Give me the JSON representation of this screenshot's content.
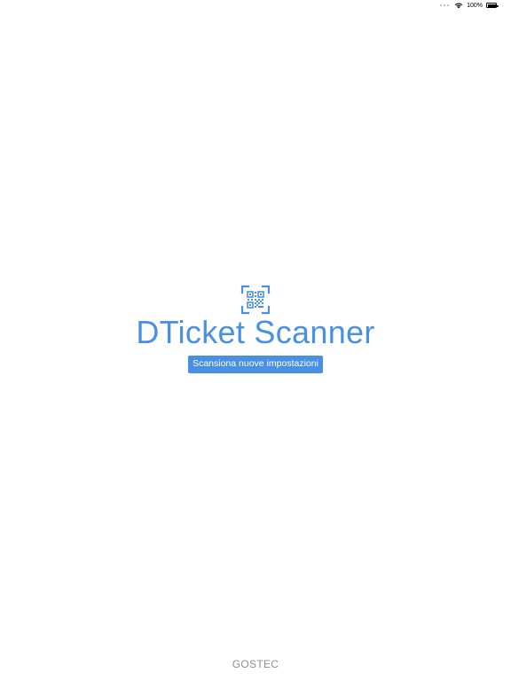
{
  "status_bar": {
    "battery_percent": "100%",
    "battery_level": 1.0
  },
  "app": {
    "title": "DTicket Scanner",
    "scan_button_label": "Scansiona nuove impostazioni",
    "footer_brand": "GOSTEC",
    "accent_color": "#4a90e2",
    "logo_icon": "qr-code-scan-icon"
  }
}
